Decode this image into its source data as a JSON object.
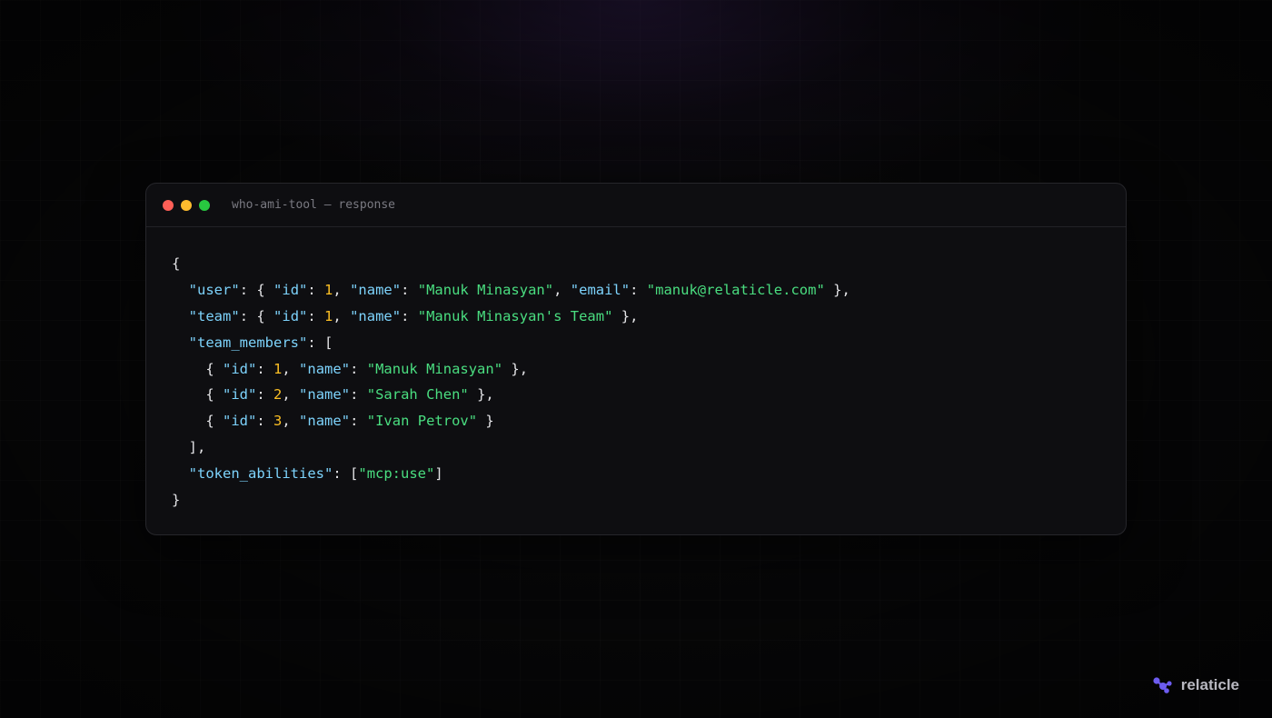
{
  "window": {
    "title": "who-ami-tool — response"
  },
  "json_response": {
    "user": {
      "id": "1",
      "name": "Manuk Minasyan",
      "email": "manuk@relaticle.com"
    },
    "team": {
      "id": "1",
      "name": "Manuk Minasyan's Team"
    },
    "team_members": [
      {
        "id": "1",
        "name": "Manuk Minasyan"
      },
      {
        "id": "2",
        "name": "Sarah Chen"
      },
      {
        "id": "3",
        "name": "Ivan Petrov"
      }
    ],
    "token_abilities": [
      "mcp:use"
    ]
  },
  "keys": {
    "user": "user",
    "team": "team",
    "team_members": "team_members",
    "token_abilities": "token_abilities",
    "id": "id",
    "name": "name",
    "email": "email"
  },
  "brand": {
    "name": "relaticle",
    "icon": "relaticle-logo-icon"
  },
  "colors": {
    "key": "#7dd3fc",
    "string": "#4ade80",
    "number": "#fbbf24",
    "punctuation": "#e4e4e7",
    "brand_logo": "#6d5cf0"
  }
}
